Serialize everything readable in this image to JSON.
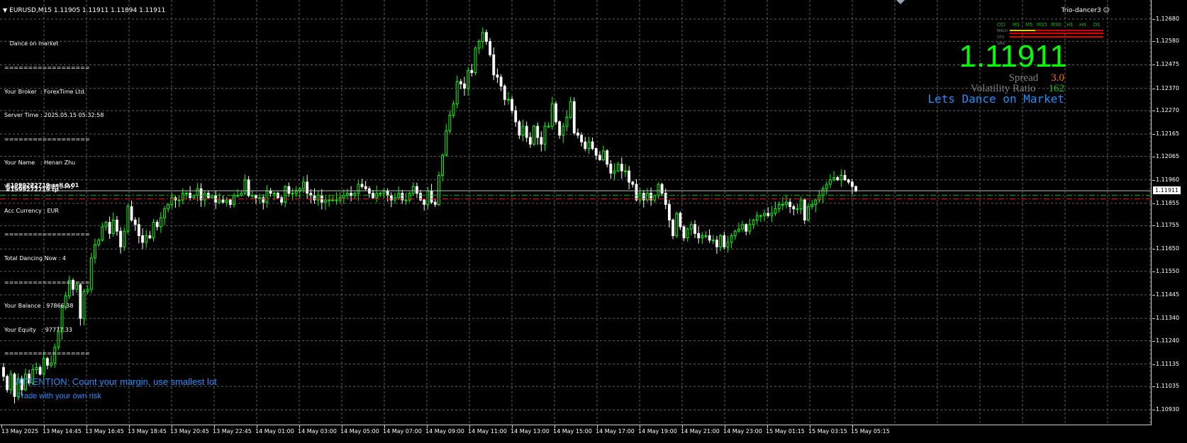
{
  "header": {
    "symbol_line": "EURUSD,M15  1.11905 1.11911 1.11894 1.11911",
    "ea_name": "Trio-dancer3 ☺"
  },
  "info_panel": {
    "lines": [
      "   Dance on market",
      "==================",
      "Your Broker  : ForexTime Ltd.",
      "Server Time : 2025.05.15 05:32:58",
      "==================",
      "Your Name   : Henan Zhu",
      "Your Acc.No  : 48610445",
      "Acc Currency : EUR",
      "==================",
      "Total Dancing Now : 4",
      "==================",
      "Your Balance : 97866.38",
      "Your Equity   : 97777.33",
      "=================="
    ]
  },
  "price_display": {
    "bid": "1.11911",
    "spread_label": "Spread",
    "spread_value": "3.0",
    "volatility_label": "Volatility Ratio",
    "volatility_value": "162",
    "tagline": "Lets Dance on Market"
  },
  "mtf_panel": {
    "headers": [
      "CCI",
      "M1",
      "M5",
      "M15",
      "M30",
      "H1",
      "H4",
      "D1"
    ],
    "rows": [
      "MACD",
      "STO",
      "SMA"
    ],
    "colors": {
      "green": "#00c000",
      "yellow": "#e8d000",
      "red": "#e00000"
    }
  },
  "messages": {
    "attention": "ATTENTION: Count your margin, use smallest lot",
    "risk": "Trade with your own risk"
  },
  "orders": {
    "label_1": "#1999272719 sell 0.01",
    "label_2": "#1999272719 tp"
  },
  "price_axis": {
    "labels": [
      "1.12680",
      "1.12580",
      "1.12475",
      "1.12370",
      "1.12270",
      "1.12165",
      "1.12065",
      "1.11960",
      "1.11855",
      "1.11755",
      "1.11650",
      "1.11550",
      "1.11445",
      "1.11340",
      "1.11240",
      "1.11135",
      "1.11035",
      "1.10930"
    ],
    "current": "1.11911"
  },
  "time_axis": {
    "labels": [
      "13 May 2025",
      "13 May 14:45",
      "13 May 16:45",
      "13 May 18:45",
      "13 May 20:45",
      "13 May 22:45",
      "14 May 01:00",
      "14 May 03:00",
      "14 May 05:00",
      "14 May 07:00",
      "14 May 09:00",
      "14 May 11:00",
      "14 May 13:00",
      "14 May 15:00",
      "14 May 17:00",
      "14 May 19:00",
      "14 May 21:00",
      "14 May 23:00",
      "15 May 01:15",
      "15 May 03:15",
      "15 May 05:15"
    ]
  },
  "chart_data": {
    "type": "candlestick",
    "symbol": "EURUSD",
    "timeframe": "M15",
    "ylim": [
      1.1088,
      1.1274
    ],
    "grid": true,
    "colors": {
      "background": "#000000",
      "bull": "#00ff00",
      "bear": "#ffffff",
      "grid": "#5f5f5f",
      "bid_line": "#c0c0c0",
      "order_line": "#00c000",
      "tp_line": "#ff0000"
    },
    "horizontal_lines": {
      "bid": 1.11911,
      "sell_entry": 1.1189,
      "take_profit": 1.11875
    },
    "closes": [
      1.1108,
      1.1102,
      1.1109,
      1.1099,
      1.1107,
      1.1102,
      1.1109,
      1.1105,
      1.1111,
      1.1112,
      1.1109,
      1.1116,
      1.1113,
      1.1114,
      1.1121,
      1.1128,
      1.1139,
      1.1144,
      1.1151,
      1.1147,
      1.1149,
      1.1134,
      1.1146,
      1.1147,
      1.1161,
      1.1167,
      1.1169,
      1.1175,
      1.1177,
      1.1172,
      1.1178,
      1.1173,
      1.1166,
      1.1173,
      1.1184,
      1.1178,
      1.1176,
      1.1171,
      1.1168,
      1.1171,
      1.117,
      1.1177,
      1.1175,
      1.1179,
      1.1183,
      1.1185,
      1.1188,
      1.1187,
      1.1187,
      1.119,
      1.119,
      1.1188,
      1.1189,
      1.1192,
      1.1187,
      1.119,
      1.1188,
      1.1189,
      1.1186,
      1.1187,
      1.1186,
      1.1187,
      1.1185,
      1.1189,
      1.1189,
      1.119,
      1.1196,
      1.1189,
      1.1189,
      1.1188,
      1.1188,
      1.1186,
      1.1191,
      1.119,
      1.119,
      1.1188,
      1.1186,
      1.1193,
      1.119,
      1.119,
      1.1191,
      1.1192,
      1.1195,
      1.119,
      1.1189,
      1.1187,
      1.1189,
      1.1186,
      1.1187,
      1.1187,
      1.1187,
      1.1187,
      1.1188,
      1.1189,
      1.119,
      1.1189,
      1.119,
      1.1194,
      1.1193,
      1.1192,
      1.119,
      1.1188,
      1.119,
      1.119,
      1.1191,
      1.1189,
      1.1187,
      1.1188,
      1.119,
      1.1187,
      1.1187,
      1.119,
      1.1193,
      1.119,
      1.1187,
      1.1185,
      1.1191,
      1.1186,
      1.1185,
      1.1198,
      1.1207,
      1.1218,
      1.1225,
      1.123,
      1.124,
      1.1239,
      1.1237,
      1.1245,
      1.1244,
      1.1255,
      1.1258,
      1.1262,
      1.1258,
      1.1252,
      1.1243,
      1.1242,
      1.1238,
      1.1232,
      1.1232,
      1.1227,
      1.1222,
      1.1216,
      1.122,
      1.1215,
      1.1212,
      1.122,
      1.1215,
      1.1212,
      1.122,
      1.122,
      1.123,
      1.1222,
      1.1216,
      1.122,
      1.1224,
      1.1231,
      1.1217,
      1.1216,
      1.1213,
      1.121,
      1.1213,
      1.121,
      1.1207,
      1.1205,
      1.1209,
      1.1203,
      1.1199,
      1.12,
      1.1203,
      1.12,
      1.12,
      1.1195,
      1.1194,
      1.1187,
      1.119,
      1.1187,
      1.119,
      1.1187,
      1.1189,
      1.1194,
      1.119,
      1.1185,
      1.1178,
      1.1171,
      1.1181,
      1.1175,
      1.117,
      1.1174,
      1.1176,
      1.1172,
      1.117,
      1.1171,
      1.1171,
      1.1169,
      1.1169,
      1.1166,
      1.1171,
      1.1166,
      1.1168,
      1.1171,
      1.1173,
      1.1174,
      1.1176,
      1.1173,
      1.1176,
      1.1178,
      1.118,
      1.118,
      1.1181,
      1.118,
      1.1181,
      1.1183,
      1.1185,
      1.1185,
      1.1186,
      1.1184,
      1.1183,
      1.1183,
      1.1187,
      1.1178,
      1.1184,
      1.1185,
      1.1187,
      1.1189,
      1.1192,
      1.1194,
      1.1196,
      1.1197,
      1.1196,
      1.1198,
      1.1196,
      1.1195,
      1.1193,
      1.1191
    ]
  }
}
